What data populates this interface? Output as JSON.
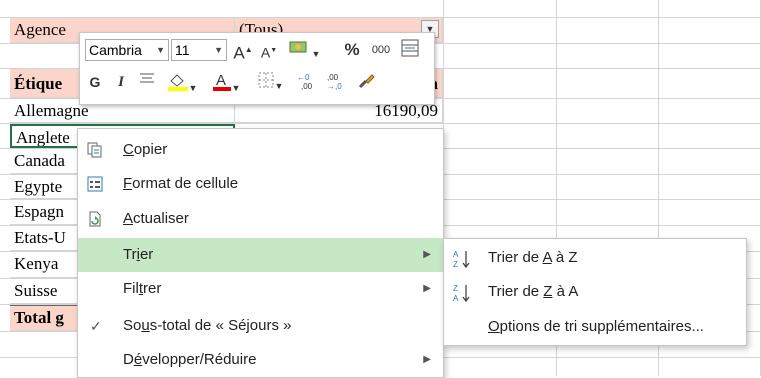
{
  "sheet": {
    "agence_label": "Agence",
    "agence_value": "(Tous)",
    "header_label": "Étique",
    "header_suffix": "a",
    "rows": [
      "Allemagne",
      "Anglete",
      "Canada",
      "Egypte",
      "Espagn",
      "Etats-U",
      "Kenya",
      "Suisse"
    ],
    "allemagne_value": "16190,09",
    "total_label": "Total g"
  },
  "mini_toolbar": {
    "font_name": "Cambria",
    "font_size": "11",
    "bold": "G",
    "italic": "I",
    "percent": "%",
    "thousands": "000"
  },
  "context_menu": {
    "items": [
      {
        "label_pre": "",
        "label_u": "C",
        "label_post": "opier",
        "icon": "copy-icon"
      },
      {
        "label_pre": "",
        "label_u": "F",
        "label_post": "ormat de cellule",
        "icon": "format-cells-icon"
      },
      {
        "label_pre": "",
        "label_u": "A",
        "label_post": "ctualiser",
        "icon": "refresh-icon"
      },
      {
        "label_pre": "Tr",
        "label_u": "i",
        "label_post": "er",
        "icon": ""
      },
      {
        "label_pre": "Fil",
        "label_u": "t",
        "label_post": "rer",
        "icon": ""
      },
      {
        "label_pre": "So",
        "label_u": "u",
        "label_post": "s-total de « Séjours »",
        "icon": "checkmark-icon"
      },
      {
        "label_pre": "D",
        "label_u": "é",
        "label_post": "velopper/Réduire",
        "icon": ""
      }
    ]
  },
  "sort_submenu": {
    "items": [
      {
        "label_pre": "Trier de ",
        "label_u": "A",
        "label_post": " à Z",
        "icon": "sort-a-z-icon"
      },
      {
        "label_pre": "Trier de ",
        "label_u": "Z",
        "label_post": " à A",
        "icon": "sort-z-a-icon"
      },
      {
        "label_pre": "",
        "label_u": "O",
        "label_post": "ptions de tri supplémentaires...",
        "icon": ""
      }
    ]
  },
  "colors": {
    "header_fill": "#fbd5ca",
    "active_item": "#c6e8c5",
    "selection_border": "#217346"
  }
}
